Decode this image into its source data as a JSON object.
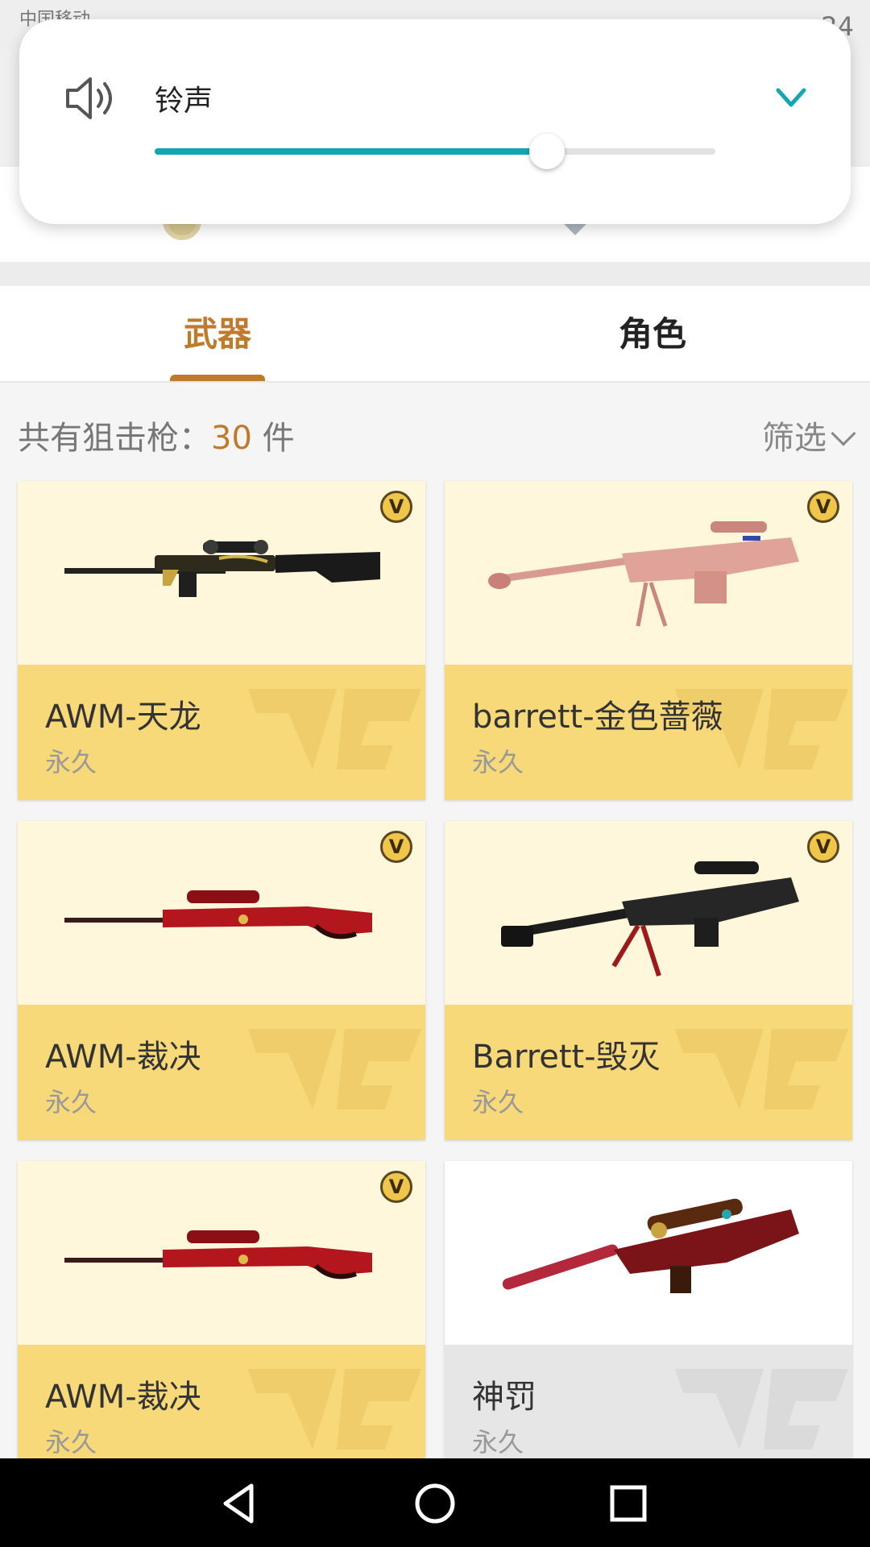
{
  "status_bar": {
    "carrier": "中国移动",
    "time": "24"
  },
  "volume_panel": {
    "label": "铃声",
    "level_percent": 70,
    "accent_color": "#14a5b3",
    "icon": "speaker-icon",
    "collapse_icon": "chevron-down-icon"
  },
  "tabs": [
    {
      "label": "武器",
      "active": true
    },
    {
      "label": "角色",
      "active": false
    }
  ],
  "count": {
    "prefix": "共有狙击枪：",
    "number": "30",
    "suffix": " 件"
  },
  "filter": {
    "label": "筛选"
  },
  "items": [
    {
      "name": "AWM-天龙",
      "duration": "永久",
      "vip": true,
      "badge": "V"
    },
    {
      "name": "barrett-金色蔷薇",
      "duration": "永久",
      "vip": true,
      "badge": "V"
    },
    {
      "name": "AWM-裁决",
      "duration": "永久",
      "vip": true,
      "badge": "V"
    },
    {
      "name": "Barrett-毁灭",
      "duration": "永久",
      "vip": true,
      "badge": "V"
    },
    {
      "name": "AWM-裁决",
      "duration": "永久",
      "vip": true,
      "badge": "V"
    },
    {
      "name": "神罚",
      "duration": "永久",
      "vip": false
    }
  ],
  "colors": {
    "accent_gold": "#c07a2b",
    "vip_card_top": "#fef7dc",
    "vip_card_bottom": "#f7d97a",
    "normal_card_bottom": "#e6e6e6"
  },
  "nav_bar": {
    "back_icon": "back-triangle-icon",
    "home_icon": "home-circle-icon",
    "recent_icon": "recent-square-icon"
  }
}
